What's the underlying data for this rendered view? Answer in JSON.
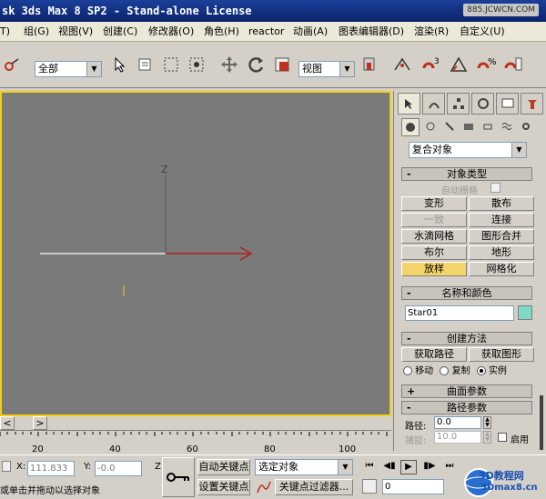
{
  "title_bar": {
    "title": "sk 3ds Max 8 SP2  - Stand-alone License",
    "watermark": "885.JCWCN.COM"
  },
  "menu": [
    {
      "label": "T)"
    },
    {
      "label": "组(G)"
    },
    {
      "label": "视图(V)"
    },
    {
      "label": "创建(C)"
    },
    {
      "label": "修改器(O)"
    },
    {
      "label": "角色(H)"
    },
    {
      "label": "reactor"
    },
    {
      "label": "动画(A)"
    },
    {
      "label": "图表编辑器(D)"
    },
    {
      "label": "渲染(R)"
    },
    {
      "label": "自定义(U)"
    }
  ],
  "toolbar": {
    "selection_filter": "全部",
    "ref_coord": "视图",
    "snap_label": "3",
    "percent_label": "%"
  },
  "command_panel": {
    "category_dropdown": "复合对象",
    "object_type": {
      "header": "对象类型",
      "autogrid_label": "自动栅格",
      "buttons": [
        {
          "label": "变形",
          "state": "normal"
        },
        {
          "label": "散布",
          "state": "normal"
        },
        {
          "label": "一致",
          "state": "disabled"
        },
        {
          "label": "连接",
          "state": "normal"
        },
        {
          "label": "水滴网格",
          "state": "normal"
        },
        {
          "label": "图形合并",
          "state": "normal"
        },
        {
          "label": "布尔",
          "state": "normal"
        },
        {
          "label": "地形",
          "state": "normal"
        },
        {
          "label": "放样",
          "state": "active"
        },
        {
          "label": "网格化",
          "state": "normal"
        }
      ]
    },
    "name_color": {
      "header": "名称和颜色",
      "name_value": "Star01",
      "color": "#7fd8c8"
    },
    "creation_method": {
      "header": "创建方法",
      "get_path": "获取路径",
      "get_shape": "获取图形",
      "radio_options": [
        {
          "label": "移动",
          "selected": false
        },
        {
          "label": "复制",
          "selected": false
        },
        {
          "label": "实例",
          "selected": true
        }
      ]
    },
    "surface_params": {
      "header": "曲面参数",
      "mark": "+"
    },
    "path_params": {
      "header": "路径参数",
      "mark": "-",
      "path_label": "路径:",
      "path_value": "0.0",
      "snap_label": "捕捉:",
      "snap_value": "10.0",
      "enable_label": "启用"
    },
    "rollout_minus": "-"
  },
  "timeline": {
    "prev": "<",
    "next": ">"
  },
  "ruler": {
    "ticks": [
      "20",
      "40",
      "60",
      "80",
      "100"
    ]
  },
  "status": {
    "x_label": "X:",
    "x_value": "111.833",
    "y_label": "Y:",
    "y_value": "-0.0",
    "z_label": "Z",
    "auto_key": "自动关键点",
    "set_key": "设置关键点",
    "selected_dropdown": "选定对象",
    "key_filters": "关键点过滤器...",
    "prompt": "或单击并拖动以选择对象",
    "frame_value": "0",
    "logo_text": "3D教程网",
    "logo_sub": "3Dmax8.cn"
  },
  "colors": {
    "viewport_bg": "#7a7a7a",
    "viewport_border": "#f0d010",
    "active_button": "#f3d46a"
  }
}
